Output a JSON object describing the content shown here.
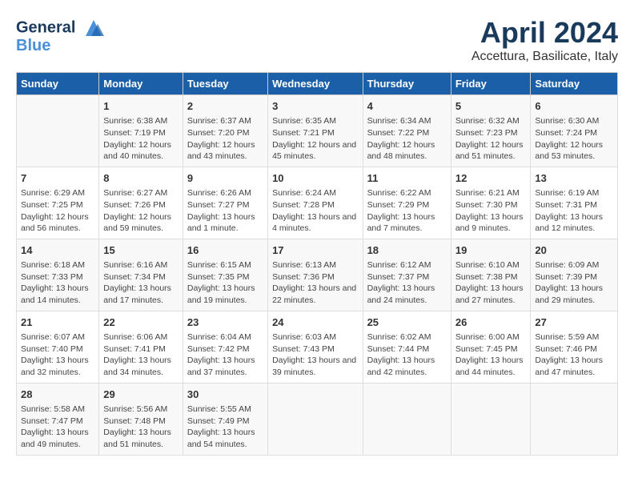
{
  "logo": {
    "line1": "General",
    "line2": "Blue"
  },
  "title": "April 2024",
  "subtitle": "Accettura, Basilicate, Italy",
  "headers": [
    "Sunday",
    "Monday",
    "Tuesday",
    "Wednesday",
    "Thursday",
    "Friday",
    "Saturday"
  ],
  "weeks": [
    [
      {
        "date": "",
        "sunrise": "",
        "sunset": "",
        "daylight": ""
      },
      {
        "date": "1",
        "sunrise": "Sunrise: 6:38 AM",
        "sunset": "Sunset: 7:19 PM",
        "daylight": "Daylight: 12 hours and 40 minutes."
      },
      {
        "date": "2",
        "sunrise": "Sunrise: 6:37 AM",
        "sunset": "Sunset: 7:20 PM",
        "daylight": "Daylight: 12 hours and 43 minutes."
      },
      {
        "date": "3",
        "sunrise": "Sunrise: 6:35 AM",
        "sunset": "Sunset: 7:21 PM",
        "daylight": "Daylight: 12 hours and 45 minutes."
      },
      {
        "date": "4",
        "sunrise": "Sunrise: 6:34 AM",
        "sunset": "Sunset: 7:22 PM",
        "daylight": "Daylight: 12 hours and 48 minutes."
      },
      {
        "date": "5",
        "sunrise": "Sunrise: 6:32 AM",
        "sunset": "Sunset: 7:23 PM",
        "daylight": "Daylight: 12 hours and 51 minutes."
      },
      {
        "date": "6",
        "sunrise": "Sunrise: 6:30 AM",
        "sunset": "Sunset: 7:24 PM",
        "daylight": "Daylight: 12 hours and 53 minutes."
      }
    ],
    [
      {
        "date": "7",
        "sunrise": "Sunrise: 6:29 AM",
        "sunset": "Sunset: 7:25 PM",
        "daylight": "Daylight: 12 hours and 56 minutes."
      },
      {
        "date": "8",
        "sunrise": "Sunrise: 6:27 AM",
        "sunset": "Sunset: 7:26 PM",
        "daylight": "Daylight: 12 hours and 59 minutes."
      },
      {
        "date": "9",
        "sunrise": "Sunrise: 6:26 AM",
        "sunset": "Sunset: 7:27 PM",
        "daylight": "Daylight: 13 hours and 1 minute."
      },
      {
        "date": "10",
        "sunrise": "Sunrise: 6:24 AM",
        "sunset": "Sunset: 7:28 PM",
        "daylight": "Daylight: 13 hours and 4 minutes."
      },
      {
        "date": "11",
        "sunrise": "Sunrise: 6:22 AM",
        "sunset": "Sunset: 7:29 PM",
        "daylight": "Daylight: 13 hours and 7 minutes."
      },
      {
        "date": "12",
        "sunrise": "Sunrise: 6:21 AM",
        "sunset": "Sunset: 7:30 PM",
        "daylight": "Daylight: 13 hours and 9 minutes."
      },
      {
        "date": "13",
        "sunrise": "Sunrise: 6:19 AM",
        "sunset": "Sunset: 7:31 PM",
        "daylight": "Daylight: 13 hours and 12 minutes."
      }
    ],
    [
      {
        "date": "14",
        "sunrise": "Sunrise: 6:18 AM",
        "sunset": "Sunset: 7:33 PM",
        "daylight": "Daylight: 13 hours and 14 minutes."
      },
      {
        "date": "15",
        "sunrise": "Sunrise: 6:16 AM",
        "sunset": "Sunset: 7:34 PM",
        "daylight": "Daylight: 13 hours and 17 minutes."
      },
      {
        "date": "16",
        "sunrise": "Sunrise: 6:15 AM",
        "sunset": "Sunset: 7:35 PM",
        "daylight": "Daylight: 13 hours and 19 minutes."
      },
      {
        "date": "17",
        "sunrise": "Sunrise: 6:13 AM",
        "sunset": "Sunset: 7:36 PM",
        "daylight": "Daylight: 13 hours and 22 minutes."
      },
      {
        "date": "18",
        "sunrise": "Sunrise: 6:12 AM",
        "sunset": "Sunset: 7:37 PM",
        "daylight": "Daylight: 13 hours and 24 minutes."
      },
      {
        "date": "19",
        "sunrise": "Sunrise: 6:10 AM",
        "sunset": "Sunset: 7:38 PM",
        "daylight": "Daylight: 13 hours and 27 minutes."
      },
      {
        "date": "20",
        "sunrise": "Sunrise: 6:09 AM",
        "sunset": "Sunset: 7:39 PM",
        "daylight": "Daylight: 13 hours and 29 minutes."
      }
    ],
    [
      {
        "date": "21",
        "sunrise": "Sunrise: 6:07 AM",
        "sunset": "Sunset: 7:40 PM",
        "daylight": "Daylight: 13 hours and 32 minutes."
      },
      {
        "date": "22",
        "sunrise": "Sunrise: 6:06 AM",
        "sunset": "Sunset: 7:41 PM",
        "daylight": "Daylight: 13 hours and 34 minutes."
      },
      {
        "date": "23",
        "sunrise": "Sunrise: 6:04 AM",
        "sunset": "Sunset: 7:42 PM",
        "daylight": "Daylight: 13 hours and 37 minutes."
      },
      {
        "date": "24",
        "sunrise": "Sunrise: 6:03 AM",
        "sunset": "Sunset: 7:43 PM",
        "daylight": "Daylight: 13 hours and 39 minutes."
      },
      {
        "date": "25",
        "sunrise": "Sunrise: 6:02 AM",
        "sunset": "Sunset: 7:44 PM",
        "daylight": "Daylight: 13 hours and 42 minutes."
      },
      {
        "date": "26",
        "sunrise": "Sunrise: 6:00 AM",
        "sunset": "Sunset: 7:45 PM",
        "daylight": "Daylight: 13 hours and 44 minutes."
      },
      {
        "date": "27",
        "sunrise": "Sunrise: 5:59 AM",
        "sunset": "Sunset: 7:46 PM",
        "daylight": "Daylight: 13 hours and 47 minutes."
      }
    ],
    [
      {
        "date": "28",
        "sunrise": "Sunrise: 5:58 AM",
        "sunset": "Sunset: 7:47 PM",
        "daylight": "Daylight: 13 hours and 49 minutes."
      },
      {
        "date": "29",
        "sunrise": "Sunrise: 5:56 AM",
        "sunset": "Sunset: 7:48 PM",
        "daylight": "Daylight: 13 hours and 51 minutes."
      },
      {
        "date": "30",
        "sunrise": "Sunrise: 5:55 AM",
        "sunset": "Sunset: 7:49 PM",
        "daylight": "Daylight: 13 hours and 54 minutes."
      },
      {
        "date": "",
        "sunrise": "",
        "sunset": "",
        "daylight": ""
      },
      {
        "date": "",
        "sunrise": "",
        "sunset": "",
        "daylight": ""
      },
      {
        "date": "",
        "sunrise": "",
        "sunset": "",
        "daylight": ""
      },
      {
        "date": "",
        "sunrise": "",
        "sunset": "",
        "daylight": ""
      }
    ]
  ]
}
